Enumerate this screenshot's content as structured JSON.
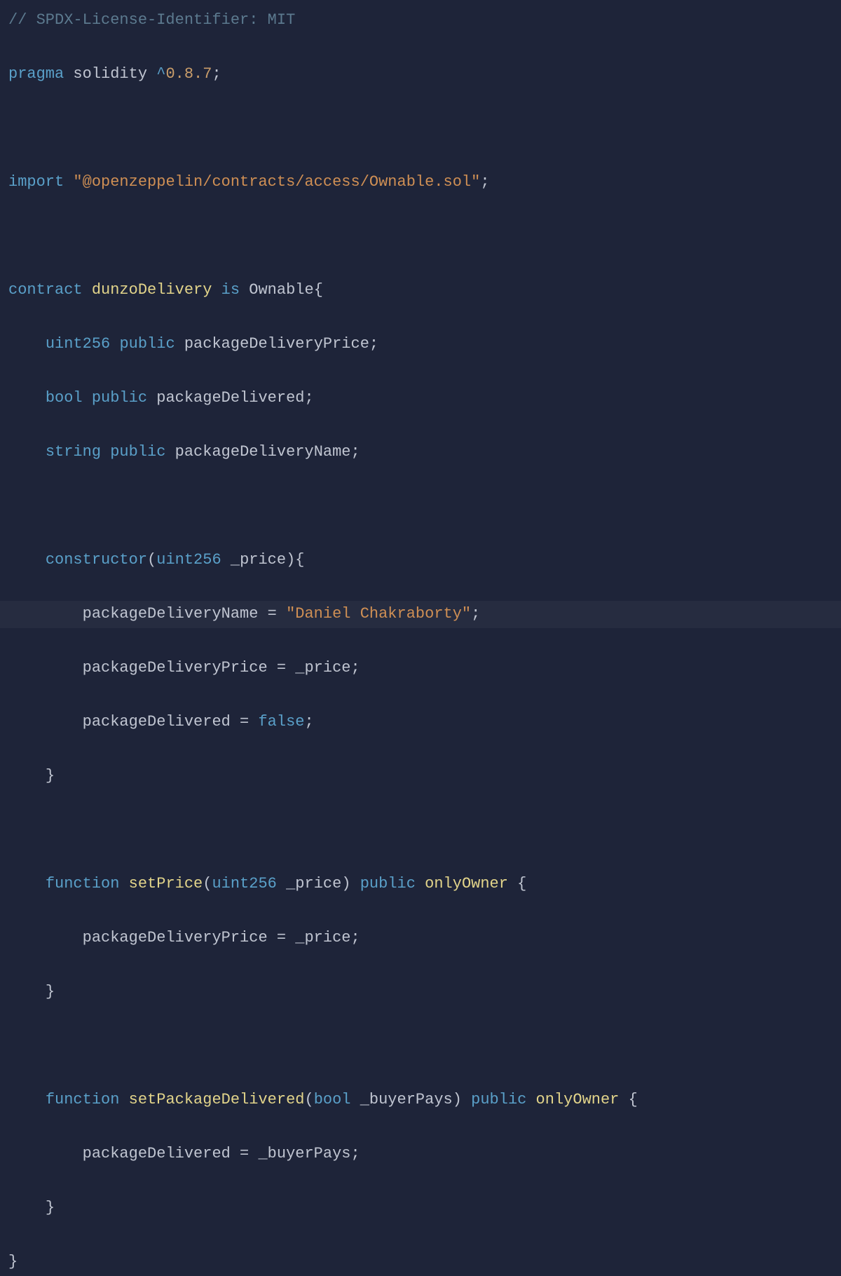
{
  "code": {
    "l1": {
      "comment": "// SPDX-License-Identifier: MIT"
    },
    "l2": {
      "pragma": "pragma",
      "solidity": "solidity",
      "caret": "^",
      "version": "0.8.7",
      "semi": ";"
    },
    "l4": {
      "import": "import",
      "path": "\"@openzeppelin/contracts/access/Ownable.sol\"",
      "semi": ";"
    },
    "l6": {
      "contract": "contract",
      "name": "dunzoDelivery",
      "is": "is",
      "parent": "Ownable",
      "brace": "{"
    },
    "l7": {
      "indent": "    ",
      "type": "uint256",
      "vis": "public",
      "name": "packageDeliveryPrice",
      "semi": ";"
    },
    "l8": {
      "indent": "    ",
      "type": "bool",
      "vis": "public",
      "name": "packageDelivered",
      "semi": ";"
    },
    "l9": {
      "indent": "    ",
      "type": "string",
      "vis": "public",
      "name": "packageDeliveryName",
      "semi": ";"
    },
    "l11": {
      "indent": "    ",
      "constructor": "constructor",
      "open": "(",
      "ptype": "uint256",
      "pname": " _price",
      "close": ")",
      "brace": "{"
    },
    "l12": {
      "indent": "        ",
      "name": "packageDeliveryName",
      "eq": " = ",
      "value": "\"Daniel Chakraborty\"",
      "semi": ";"
    },
    "l13": {
      "indent": "        ",
      "name": "packageDeliveryPrice",
      "eq": " = ",
      "value": "_price",
      "semi": ";"
    },
    "l14": {
      "indent": "        ",
      "name": "packageDelivered",
      "eq": " = ",
      "value": "false",
      "semi": ";"
    },
    "l15": {
      "indent": "    ",
      "brace": "}"
    },
    "l17": {
      "indent": "    ",
      "fn": "function",
      "name": "setPrice",
      "open": "(",
      "ptype": "uint256",
      "pname": " _price",
      "close": ") ",
      "vis": "public",
      "mod": " onlyOwner ",
      "brace": "{"
    },
    "l18": {
      "indent": "        ",
      "name": "packageDeliveryPrice",
      "eq": " = ",
      "value": "_price",
      "semi": ";"
    },
    "l19": {
      "indent": "    ",
      "brace": "}"
    },
    "l21": {
      "indent": "    ",
      "fn": "function",
      "name": "setPackageDelivered",
      "open": "(",
      "ptype": "bool",
      "pname": " _buyerPays",
      "close": ") ",
      "vis": "public",
      "mod": " onlyOwner ",
      "brace": "{"
    },
    "l22": {
      "indent": "        ",
      "name": "packageDelivered",
      "eq": " = ",
      "value": "_buyerPays",
      "semi": ";"
    },
    "l23": {
      "indent": "    ",
      "brace": "}"
    },
    "l24": {
      "brace": "}"
    }
  }
}
